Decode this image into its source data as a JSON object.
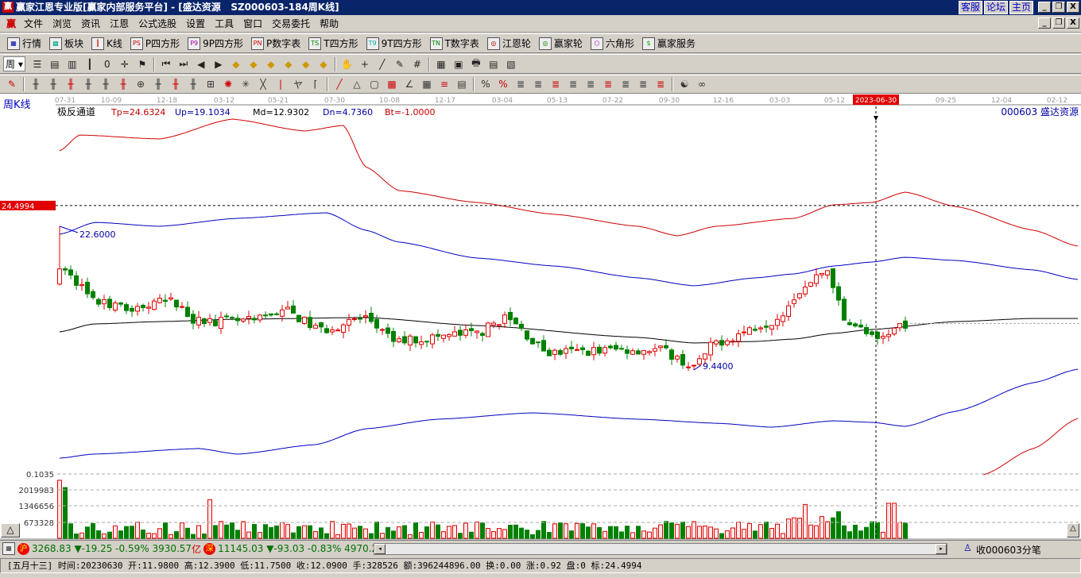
{
  "window": {
    "logo": "赢",
    "title": "赢家江恩专业版[赢家内部服务平台] - [盛达资源   SZ000603-184周K线]",
    "links": [
      "客服",
      "论坛",
      "主页"
    ],
    "buttons": [
      "_",
      "❐",
      "X"
    ]
  },
  "menu": {
    "logo": "赢",
    "items": [
      "文件",
      "浏览",
      "资讯",
      "江恩",
      "公式选股",
      "设置",
      "工具",
      "窗口",
      "交易委托",
      "帮助"
    ]
  },
  "toolbar1": [
    {
      "icon": "grid-icon",
      "glyph": "▦",
      "label": "行情"
    },
    {
      "icon": "blocks-icon",
      "glyph": "▩",
      "label": "板块"
    },
    {
      "icon": "candles-icon",
      "glyph": "┃",
      "label": "K线"
    },
    {
      "icon": "ps-icon",
      "glyph": "PS",
      "label": "P四方形"
    },
    {
      "icon": "p9-icon",
      "glyph": "P9",
      "label": "9P四方形"
    },
    {
      "icon": "pn-icon",
      "glyph": "PN",
      "label": "P数字表"
    },
    {
      "icon": "ts-icon",
      "glyph": "TS",
      "label": "T四方形"
    },
    {
      "icon": "t9-icon",
      "glyph": "T9",
      "label": "9T四方形"
    },
    {
      "icon": "tn-icon",
      "glyph": "TN",
      "label": "T数字表"
    },
    {
      "icon": "gann-wheel-icon",
      "glyph": "◎",
      "label": "江恩轮"
    },
    {
      "icon": "winner-wheel-icon",
      "glyph": "◎",
      "label": "赢家轮"
    },
    {
      "icon": "hexagon-icon",
      "glyph": "⬡",
      "label": "六角形"
    },
    {
      "icon": "dollar-icon",
      "glyph": "$",
      "label": "赢家服务"
    }
  ],
  "toolbar2": {
    "period": "周",
    "icons": [
      "list-icon",
      "doc-icon",
      "chart-small-icon",
      "candle-icon",
      "zero-icon",
      "crosshair-icon",
      "flag-icon",
      "first-icon",
      "last-icon",
      "prev-icon",
      "next-icon",
      "diamond-1-icon",
      "diamond-2-icon",
      "diamond-3-icon",
      "diamond-4-icon",
      "diamond-5-icon",
      "diamond-6-icon",
      "hand-icon",
      "cross-icon",
      "line-icon",
      "draw-icon",
      "hash-icon",
      "calendar-icon",
      "calc-icon",
      "print-icon",
      "save-icon",
      "export-icon"
    ]
  },
  "toolbar3": {
    "icons": [
      "pencil-icon",
      "bars-1-icon",
      "bars-2-icon",
      "bars-3-icon",
      "bars-4-icon",
      "bars-5-icon",
      "bars-6-icon",
      "circle-grid-icon",
      "parallel-icon",
      "fan-icon",
      "arrows-icon",
      "square-cross-icon",
      "cycle-icon",
      "star-icon",
      "box-icon",
      "wave-icon",
      "columns-icon",
      "bracket-icon",
      "slash-icon",
      "triangle-icon",
      "square-icon",
      "gann-box-icon",
      "angle-icon",
      "grid-small-icon",
      "lines-icon",
      "table-icon",
      "percent-fan-icon",
      "percent-icon",
      "level-1-icon",
      "level-2-icon",
      "level-3-icon",
      "level-4-icon",
      "level-5-icon",
      "level-6-icon",
      "level-7-icon",
      "level-8-icon",
      "level-9-icon",
      "yin-yang-icon",
      "infinity-icon"
    ]
  },
  "chart": {
    "period_label": "周K线",
    "indicator_name": "极反通道",
    "params": [
      {
        "text": "Tp=24.6324",
        "color": "#c00000"
      },
      {
        "text": "Up=19.1034",
        "color": "#0000a0"
      },
      {
        "text": "Md=12.9302",
        "color": "#000000"
      },
      {
        "text": "Dn=4.7360",
        "color": "#0000a0"
      },
      {
        "text": "Bt=-1.0000",
        "color": "#c00000"
      }
    ],
    "stock": "000603  盛达资源",
    "dates": [
      "07-31",
      "10-09",
      "12-18",
      "03-12",
      "05-21",
      "07-30",
      "10-08",
      "12-17",
      "03-04",
      "05-13",
      "07-22",
      "09-30",
      "12-16",
      "03-03",
      "05-12",
      "2023-06-30",
      "09-25",
      "12-04",
      "02-12"
    ],
    "highlight_date_index": 15,
    "price_marker": "24.4994",
    "high_label": "22.6000",
    "low_label": "9.4400",
    "volume_ticks": [
      "0.1035",
      "2019983",
      "1346656",
      "673328"
    ],
    "volume_button": "△"
  },
  "chart_data": {
    "type": "candlestick",
    "weeks_total": 184,
    "close_keypoints": [
      [
        0,
        18.7
      ],
      [
        4,
        17.1
      ],
      [
        6,
        15.7
      ],
      [
        12,
        15
      ],
      [
        20,
        15.7
      ],
      [
        25,
        13.9
      ],
      [
        35,
        13.9
      ],
      [
        40,
        15
      ],
      [
        47,
        13.1
      ],
      [
        55,
        14.2
      ],
      [
        60,
        12.1
      ],
      [
        75,
        12.8
      ],
      [
        80,
        14.2
      ],
      [
        88,
        11
      ],
      [
        100,
        11.3
      ],
      [
        108,
        11.3
      ],
      [
        114,
        9.7
      ],
      [
        118,
        12
      ],
      [
        128,
        13.9
      ],
      [
        134,
        17.1
      ],
      [
        138,
        18.6
      ],
      [
        141,
        14.2
      ],
      [
        147,
        12.1
      ],
      [
        152,
        13.7
      ]
    ],
    "high": 22.6,
    "low": 9.44,
    "bands": [
      {
        "name": "Tp",
        "color": "#d00000",
        "points": [
          [
            0,
            29.51
          ],
          [
            3.6,
            30.96
          ],
          [
            18,
            30.6
          ],
          [
            31,
            32.42
          ],
          [
            44,
            31.33
          ],
          [
            51,
            31.84
          ],
          [
            55,
            28.05
          ],
          [
            61,
            25.87
          ],
          [
            75,
            24.78
          ],
          [
            89,
            23.69
          ],
          [
            104,
            22.6
          ],
          [
            111,
            21.73
          ],
          [
            118,
            22.6
          ],
          [
            132,
            23.33
          ],
          [
            139,
            24.56
          ],
          [
            146,
            24.78
          ],
          [
            152,
            25.73
          ],
          [
            161,
            24.42
          ],
          [
            175,
            22.24
          ],
          [
            183,
            20.78
          ]
        ]
      },
      {
        "name": "Up",
        "color": "#0000c0",
        "points": [
          [
            0,
            21.87
          ],
          [
            6.4,
            22.96
          ],
          [
            18,
            22.6
          ],
          [
            32,
            23.33
          ],
          [
            48,
            23.84
          ],
          [
            55,
            22.24
          ],
          [
            61,
            21.15
          ],
          [
            75,
            19.69
          ],
          [
            89,
            18.96
          ],
          [
            104,
            17.87
          ],
          [
            114,
            17.15
          ],
          [
            125,
            17.87
          ],
          [
            132,
            18.24
          ],
          [
            139,
            18.96
          ],
          [
            146,
            19.33
          ],
          [
            152,
            19.76
          ],
          [
            161,
            19.47
          ],
          [
            175,
            18.6
          ],
          [
            183,
            17.73
          ]
        ]
      },
      {
        "name": "Md",
        "color": "#000000",
        "points": [
          [
            0,
            12.93
          ],
          [
            6,
            13.65
          ],
          [
            18,
            13.87
          ],
          [
            32,
            14.09
          ],
          [
            55,
            14.24
          ],
          [
            75,
            13.51
          ],
          [
            104,
            12.42
          ],
          [
            114,
            11.91
          ],
          [
            125,
            12.05
          ],
          [
            132,
            12.27
          ],
          [
            139,
            12.78
          ],
          [
            146,
            13.15
          ],
          [
            161,
            13.87
          ],
          [
            175,
            14.16
          ],
          [
            183,
            14.16
          ]
        ]
      },
      {
        "name": "Dn",
        "color": "#0000c0",
        "points": [
          [
            0,
            1.36
          ],
          [
            6,
            1.73
          ],
          [
            25,
            2.24
          ],
          [
            32,
            1.73
          ],
          [
            46,
            2.6
          ],
          [
            55,
            4.05
          ],
          [
            68,
            4.93
          ],
          [
            85,
            5.51
          ],
          [
            104,
            4.93
          ],
          [
            118,
            4.56
          ],
          [
            128,
            4.2
          ],
          [
            139,
            4.78
          ],
          [
            146,
            4.64
          ],
          [
            152,
            4.27
          ],
          [
            161,
            5.65
          ],
          [
            175,
            8.27
          ],
          [
            183,
            9.51
          ]
        ]
      },
      {
        "name": "Bt",
        "color": "#d00000",
        "points": [
          [
            166,
            -0.16
          ],
          [
            175,
            2.24
          ],
          [
            183,
            5.0
          ]
        ]
      }
    ],
    "volume_spikes": [
      [
        0,
        2400000
      ],
      [
        1,
        2100000
      ],
      [
        27,
        1600000
      ],
      [
        134,
        1400000
      ],
      [
        140,
        1100000
      ],
      [
        149,
        1450000
      ],
      [
        150,
        1450000
      ]
    ]
  },
  "bottom": {
    "sh_value": "3268.83",
    "sh_change": "▼-19.25 -0.59% 3930.57",
    "sh_unit": "亿",
    "sz_value": "11145.03",
    "sz_change": "▼-93.03 -0.83% 4970.2",
    "sh_badge": "沪",
    "sz_badge": "深",
    "tick_label": "收000603分笔"
  },
  "status": "[五月十三] 时间:20230630 开:11.9800 高:12.3900 低:11.7500 收:12.0900 手:328526 额:396244896.00 换:0.00 涨:0.92 盘:0 标:24.4994"
}
